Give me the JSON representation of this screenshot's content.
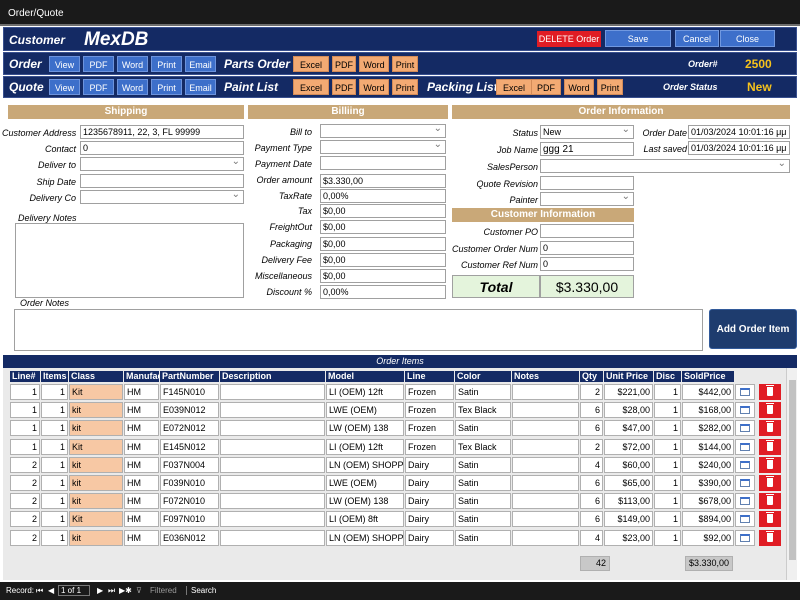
{
  "window": {
    "title": "Order/Quote"
  },
  "header": {
    "customer_label": "Customer",
    "app_name": "MexDB",
    "delete_label": "DELETE Order",
    "save_label": "Save",
    "cancel_label": "Cancel",
    "close_label": "Close",
    "order_label": "Order",
    "quote_label": "Quote",
    "view": "View",
    "pdf": "PDF",
    "word": "Word",
    "print": "Print",
    "email": "Email",
    "excel": "Excel",
    "parts_order_label": "Parts Order",
    "paint_list_label": "Paint List",
    "packing_list_label": "Packing List",
    "order_num_label": "Order#",
    "order_num": "2500",
    "order_status_label": "Order Status",
    "order_status": "New"
  },
  "shipping": {
    "title": "Shipping",
    "customer_address_label": "Customer Address",
    "customer_address": "1235678911, 22, 3, FL 99999",
    "contact_label": "Contact",
    "contact": "0",
    "deliver_to_label": "Deliver to",
    "deliver_to": "",
    "ship_date_label": "Ship Date",
    "ship_date": "",
    "delivery_co_label": "Delivery Co",
    "delivery_co": "",
    "delivery_notes_label": "Delivery Notes",
    "order_notes_label": "Order Notes"
  },
  "billing": {
    "title": "Billiing",
    "bill_to_label": "Bill to",
    "payment_type_label": "Payment Type",
    "payment_date_label": "Payment Date",
    "order_amount_label": "Order amount",
    "order_amount": "$3.330,00",
    "taxrate_label": "TaxRate",
    "taxrate": "0,00%",
    "tax_label": "Tax",
    "tax": "$0,00",
    "freightout_label": "FreightOut",
    "freightout": "$0,00",
    "packaging_label": "Packaging",
    "packaging": "$0,00",
    "delivery_fee_label": "Delivery Fee",
    "delivery_fee": "$0,00",
    "misc_label": "Miscellaneous",
    "misc": "$0,00",
    "discount_label": "Discount %",
    "discount": "0,00%"
  },
  "order_info": {
    "title": "Order Information",
    "status_label": "Status",
    "status": "New",
    "order_date_label": "Order Date",
    "order_date": "01/03/2024 10:01:16 μμ",
    "job_name_label": "Job Name",
    "job_name": "ggg 21",
    "last_saved_label": "Last saved",
    "last_saved": "01/03/2024 10:01:16 μμ",
    "salesperson_label": "SalesPerson",
    "quote_revision_label": "Quote Revision",
    "painter_label": "Painter"
  },
  "customer_info": {
    "title": "Customer Information",
    "po_label": "Customer PO",
    "po": "",
    "order_num_label": "Customer Order Num",
    "order_num": "0",
    "ref_num_label": "Customer Ref Num",
    "ref_num": "0"
  },
  "total": {
    "label": "Total",
    "value": "$3.330,00"
  },
  "add_item_label": "Add Order Item",
  "grid": {
    "title": "Order Items",
    "columns": [
      "Line#",
      "Items",
      "Class",
      "Manufac",
      "PartNumber",
      "Description",
      "Model",
      "Line",
      "Color",
      "Notes",
      "Qty",
      "Unit Price",
      "Disc",
      "SoldPrice"
    ],
    "rows": [
      [
        "1",
        "1",
        "Kit",
        "HM",
        "F145N010",
        "",
        "LI (OEM) 12ft",
        "Frozen",
        "Satin",
        "",
        "2",
        "$221,00",
        "1",
        "$442,00"
      ],
      [
        "1",
        "1",
        "kit",
        "HM",
        "E039N012",
        "",
        "LWE (OEM)",
        "Frozen",
        "Tex Black",
        "",
        "6",
        "$28,00",
        "1",
        "$168,00"
      ],
      [
        "1",
        "1",
        "kit",
        "HM",
        "E072N012",
        "",
        "LW (OEM) 138",
        "Frozen",
        "Satin",
        "",
        "6",
        "$47,00",
        "1",
        "$282,00"
      ],
      [
        "1",
        "1",
        "Kit",
        "HM",
        "E145N012",
        "",
        "LI (OEM) 12ft",
        "Frozen",
        "Tex Black",
        "",
        "2",
        "$72,00",
        "1",
        "$144,00"
      ],
      [
        "2",
        "1",
        "kit",
        "HM",
        "F037N004",
        "",
        "LN (OEM) SHOPPING",
        "Dairy",
        "Satin",
        "",
        "4",
        "$60,00",
        "1",
        "$240,00"
      ],
      [
        "2",
        "1",
        "kit",
        "HM",
        "F039N010",
        "",
        "LWE (OEM)",
        "Dairy",
        "Satin",
        "",
        "6",
        "$65,00",
        "1",
        "$390,00"
      ],
      [
        "2",
        "1",
        "kit",
        "HM",
        "F072N010",
        "",
        "LW (OEM) 138",
        "Dairy",
        "Satin",
        "",
        "6",
        "$113,00",
        "1",
        "$678,00"
      ],
      [
        "2",
        "1",
        "Kit",
        "HM",
        "F097N010",
        "",
        "LI (OEM) 8ft",
        "Dairy",
        "Satin",
        "",
        "6",
        "$149,00",
        "1",
        "$894,00"
      ],
      [
        "2",
        "1",
        "kit",
        "HM",
        "E036N012",
        "",
        "LN (OEM) SHOPPING",
        "Dairy",
        "Satin",
        "",
        "4",
        "$23,00",
        "1",
        "$92,00"
      ]
    ],
    "qty_total": "42",
    "sold_total": "$3.330,00"
  },
  "statusbar": {
    "record_label": "Record:",
    "first": "⏮",
    "prev": "◀",
    "record_pos": "1 of 1",
    "next": "▶",
    "last": "⏭",
    "new": "▶✱",
    "filtered": "Filtered",
    "search": "Search"
  }
}
